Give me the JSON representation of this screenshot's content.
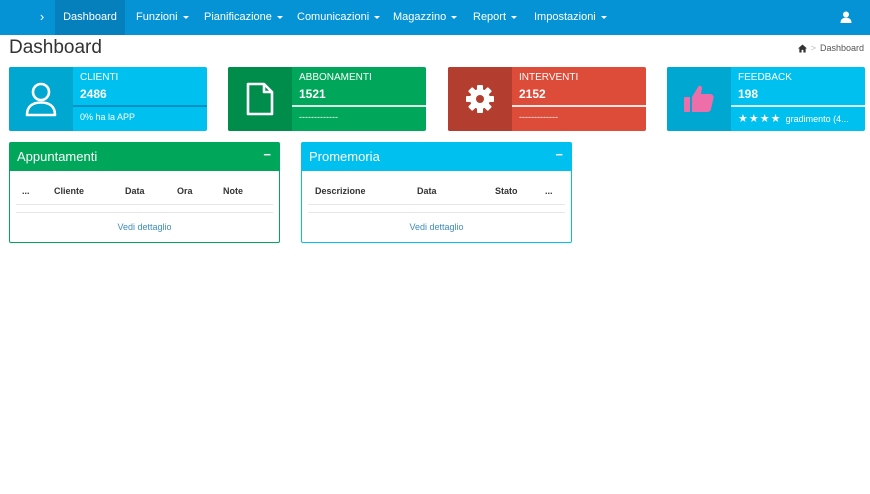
{
  "nav": {
    "toggle_glyph": "›",
    "items": [
      {
        "label": "Dashboard",
        "has_caret": false,
        "active": true
      },
      {
        "label": "Funzioni",
        "has_caret": true
      },
      {
        "label": "Pianificazione",
        "has_caret": true
      },
      {
        "label": "Comunicazioni",
        "has_caret": true
      },
      {
        "label": "Magazzino",
        "has_caret": true
      },
      {
        "label": "Report",
        "has_caret": true
      },
      {
        "label": "Impostazioni",
        "has_caret": true
      }
    ],
    "user_icon": "user-icon"
  },
  "page": {
    "title": "Dashboard",
    "breadcrumb": {
      "home_icon": "home-icon",
      "current": "Dashboard"
    }
  },
  "stats": [
    {
      "label": "CLIENTI",
      "value": "2486",
      "footer": "0% ha la APP",
      "icon": "user-outline-icon",
      "color": "#00c0ef",
      "icon_bg": "#00a7d0"
    },
    {
      "label": "ABBONAMENTI",
      "value": "1521",
      "footer": "-------------",
      "icon": "file-outline-icon",
      "color": "#00a65a",
      "icon_bg": "#008d4c"
    },
    {
      "label": "INTERVENTI",
      "value": "2152",
      "footer": "-------------",
      "icon": "gear-icon",
      "color": "#dd4b39",
      "icon_bg": "#b33d2f"
    },
    {
      "label": "FEEDBACK",
      "value": "198",
      "footer": "gradimento (4...",
      "stars": 4,
      "icon": "thumbs-up-icon",
      "color": "#00c0ef",
      "icon_bg": "#00a7d0"
    }
  ],
  "panels": {
    "appuntamenti": {
      "title": "Appuntamenti",
      "collapse": "−",
      "columns": [
        "...",
        "Cliente",
        "Data",
        "Ora",
        "Note"
      ],
      "link": "Vedi dettaglio",
      "color": "#00a65a"
    },
    "promemoria": {
      "title": "Promemoria",
      "collapse": "−",
      "columns": [
        "Descrizione",
        "Data",
        "Stato",
        "..."
      ],
      "link": "Vedi dettaglio",
      "color": "#00c0ef"
    }
  }
}
